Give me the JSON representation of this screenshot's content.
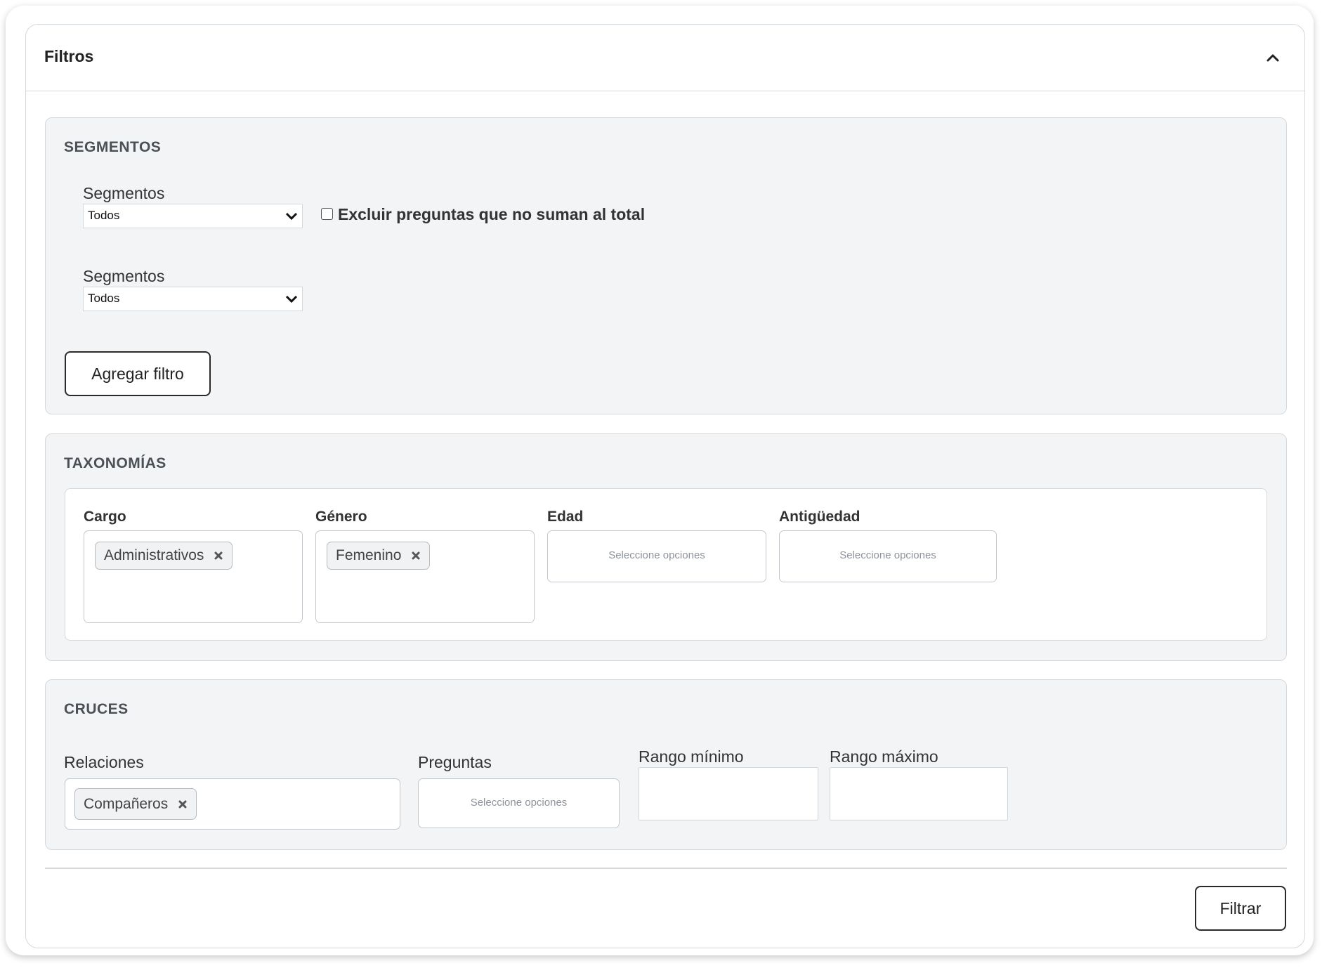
{
  "card": {
    "title": "Filtros"
  },
  "segmentos": {
    "title": "SEGMENTOS",
    "rows": [
      {
        "label": "Segmentos",
        "value": "Todos"
      },
      {
        "label": "Segmentos",
        "value": "Todos"
      }
    ],
    "exclude_label": "Excluir preguntas que no suman al total",
    "exclude_checked": false,
    "add_filter_label": "Agregar filtro"
  },
  "taxonomias": {
    "title": "TAXONOMÍAS",
    "fields": [
      {
        "label": "Cargo",
        "chips": [
          "Administrativos"
        ],
        "placeholder": ""
      },
      {
        "label": "Género",
        "chips": [
          "Femenino"
        ],
        "placeholder": ""
      },
      {
        "label": "Edad",
        "chips": [],
        "placeholder": "Seleccione opciones"
      },
      {
        "label": "Antigüedad",
        "chips": [],
        "placeholder": "Seleccione opciones"
      }
    ]
  },
  "cruces": {
    "title": "CRUCES",
    "relaciones": {
      "label": "Relaciones",
      "chips": [
        "Compañeros"
      ]
    },
    "preguntas": {
      "label": "Preguntas",
      "placeholder": "Seleccione opciones"
    },
    "rango_minimo": {
      "label": "Rango mínimo",
      "value": ""
    },
    "rango_maximo": {
      "label": "Rango máximo",
      "value": ""
    }
  },
  "footer": {
    "filter_button": "Filtrar"
  }
}
